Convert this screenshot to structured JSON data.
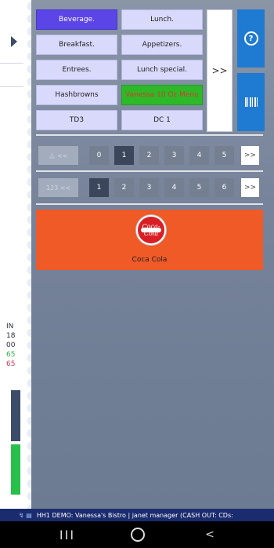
{
  "left_panel": {
    "lines": [
      {
        "text": "IN",
        "color": "#2b2f38"
      },
      {
        "text": "18",
        "color": "#2b2f38"
      },
      {
        "text": "00",
        "color": "#2b2f38"
      },
      {
        "text": "65",
        "color": "#2fb24a"
      },
      {
        "text": "65",
        "color": "#c43b5c"
      }
    ],
    "bar_colors": [
      "#3c4d69",
      "#27c04a"
    ]
  },
  "categories": [
    {
      "label": "Beverage.",
      "state": "active"
    },
    {
      "label": "Lunch.",
      "state": "normal"
    },
    {
      "label": "Breakfast.",
      "state": "normal"
    },
    {
      "label": "Appetizers.",
      "state": "normal"
    },
    {
      "label": "Entrees.",
      "state": "normal"
    },
    {
      "label": "Lunch special.",
      "state": "normal"
    },
    {
      "label": "Hashbrowns",
      "state": "normal"
    },
    {
      "label": "Vanessa 10 Oz Menu",
      "state": "green"
    },
    {
      "label": "TD3",
      "state": "normal"
    },
    {
      "label": "DC 1",
      "state": "normal"
    }
  ],
  "more_button": ">>",
  "side_buttons": {
    "help": "?",
    "barcode": "barcode-icon"
  },
  "pager1": {
    "first": "⏅ <<",
    "pages": [
      "0",
      "1",
      "2",
      "3",
      "4",
      "5"
    ],
    "active": "1",
    "next": ">>"
  },
  "pager2": {
    "first": "123 <<",
    "pages": [
      "1",
      "2",
      "3",
      "4",
      "5",
      "6"
    ],
    "active": "1",
    "next": ">>"
  },
  "product": {
    "name": "Coca Cola",
    "logo_text": "Coca-Cola",
    "color": "#ef5a27"
  },
  "status_bar": {
    "text": "HH1  DEMO: Vanessa's Bistro | janet manager (CASH OUT: CDs:"
  },
  "nav": {
    "recent": "III",
    "home": "O",
    "back": "<"
  }
}
